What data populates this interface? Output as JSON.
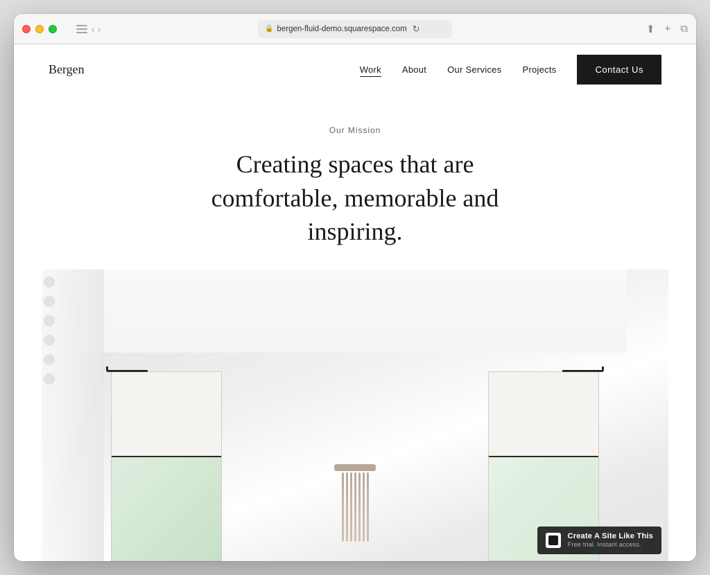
{
  "browser": {
    "url": "bergen-fluid-demo.squarespace.com",
    "lock_icon": "🔒",
    "refresh_icon": "↻",
    "share_icon": "⬆",
    "plus_icon": "+",
    "tabs_icon": "⧉",
    "back_arrow": "‹",
    "forward_arrow": "›"
  },
  "site": {
    "logo": "Bergen",
    "nav": {
      "links": [
        {
          "label": "Work",
          "active": true
        },
        {
          "label": "About",
          "active": false
        },
        {
          "label": "Our Services",
          "active": false
        },
        {
          "label": "Projects",
          "active": false
        }
      ],
      "contact_button": "Contact Us"
    },
    "hero": {
      "mission_label": "Our Mission",
      "headline": "Creating spaces that are comfortable, memorable and inspiring."
    },
    "squarespace_badge": {
      "title": "Create A Site Like This",
      "subtitle": "Free trial. Instant access."
    }
  }
}
